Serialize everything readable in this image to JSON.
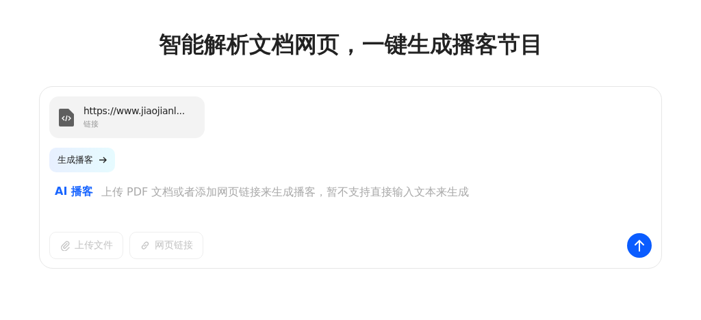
{
  "title": "智能解析文档网页，一键生成播客节目",
  "attachment": {
    "name": "https://www.jiaojianl...",
    "type_label": "链接"
  },
  "generate_button": {
    "label": "生成播客"
  },
  "prompt": {
    "prefix": "AI 播客",
    "placeholder": "上传 PDF 文档或者添加网页链接来生成播客，暂不支持直接输入文本来生成"
  },
  "tools": [
    {
      "kind": "upload",
      "label": "上传文件",
      "disabled": true
    },
    {
      "kind": "link",
      "label": "网页链接",
      "disabled": true
    }
  ],
  "send_button": {
    "disabled": false
  }
}
